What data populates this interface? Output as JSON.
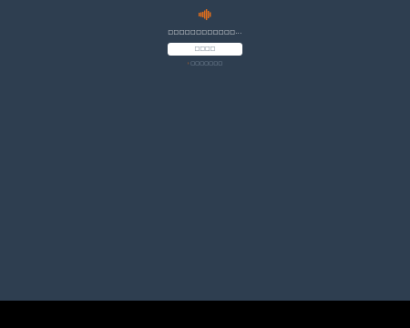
{
  "colors": {
    "background": "#2e3e50",
    "accent": "#e8701a",
    "button_background": "#ffffff",
    "bottom_bar": "#000000"
  },
  "logo": {
    "icon": "soundcloud-logo-icon"
  },
  "message": {
    "text": "□□□□□□□□□□□□..."
  },
  "primary_button": {
    "label": "□□□□"
  },
  "secondary_link": {
    "arrow": "›",
    "label": "□□□□□□□"
  }
}
